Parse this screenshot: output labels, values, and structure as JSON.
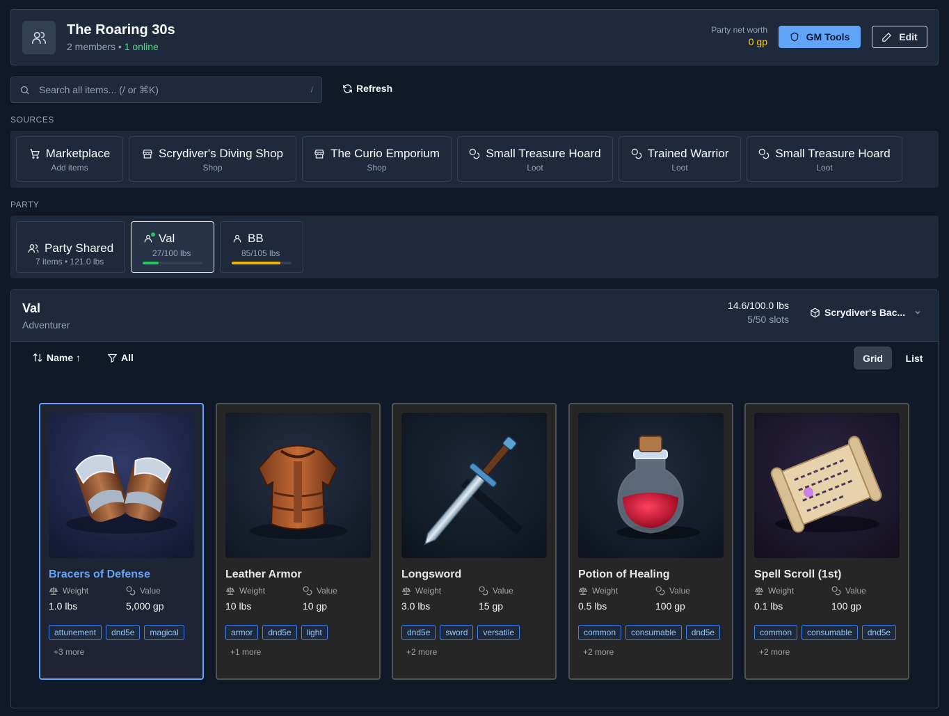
{
  "header": {
    "title": "The Roaring 30s",
    "members": "2 members",
    "separator": "•",
    "online": "1 online",
    "net_worth_label": "Party net worth",
    "net_worth_value": "0 gp",
    "gm_tools_label": "GM Tools",
    "edit_label": "Edit"
  },
  "search": {
    "placeholder": "Search all items... (/ or ⌘K)",
    "shortcut": "/",
    "refresh_label": "Refresh"
  },
  "sources": {
    "label": "SOURCES",
    "items": [
      {
        "name": "Marketplace",
        "sub": "Add items",
        "icon": "cart-icon"
      },
      {
        "name": "Scrydiver's Diving Shop",
        "sub": "Shop",
        "icon": "store-icon"
      },
      {
        "name": "The Curio Emporium",
        "sub": "Shop",
        "icon": "store-icon"
      },
      {
        "name": "Small Treasure Hoard",
        "sub": "Loot",
        "icon": "coins-icon"
      },
      {
        "name": "Trained Warrior",
        "sub": "Loot",
        "icon": "coins-icon"
      },
      {
        "name": "Small Treasure Hoard",
        "sub": "Loot",
        "icon": "coins-icon"
      }
    ]
  },
  "party": {
    "label": "PARTY",
    "shared": {
      "name": "Party Shared",
      "sub": "7 items • 121.0 lbs"
    },
    "members": [
      {
        "name": "Val",
        "sub": "27/100 lbs",
        "load": 0.27,
        "bar_color": "#22c55e",
        "online": true
      },
      {
        "name": "BB",
        "sub": "85/105 lbs",
        "load": 0.81,
        "bar_color": "#eab308",
        "online": false
      }
    ]
  },
  "inventory": {
    "name": "Val",
    "role": "Adventurer",
    "weight": "14.6/100.0 lbs",
    "slots": "5/50 slots",
    "container": "Scrydiver's Bac...",
    "sort_label": "Name ↑",
    "filter_label": "All",
    "view_grid": "Grid",
    "view_list": "List",
    "weight_label": "Weight",
    "value_label": "Value",
    "items": [
      {
        "name": "Bracers of Defense",
        "weight": "1.0 lbs",
        "value": "5,000 gp",
        "tags": [
          "attunement",
          "dnd5e",
          "magical"
        ],
        "more": "+3 more"
      },
      {
        "name": "Leather Armor",
        "weight": "10 lbs",
        "value": "10 gp",
        "tags": [
          "armor",
          "dnd5e",
          "light"
        ],
        "more": "+1 more"
      },
      {
        "name": "Longsword",
        "weight": "3.0 lbs",
        "value": "15 gp",
        "tags": [
          "dnd5e",
          "sword",
          "versatile"
        ],
        "more": "+2 more"
      },
      {
        "name": "Potion of Healing",
        "weight": "0.5 lbs",
        "value": "100 gp",
        "tags": [
          "common",
          "consumable",
          "dnd5e"
        ],
        "more": "+2 more"
      },
      {
        "name": "Spell Scroll (1st)",
        "weight": "0.1 lbs",
        "value": "100 gp",
        "tags": [
          "common",
          "consumable",
          "dnd5e"
        ],
        "more": "+2 more"
      }
    ]
  },
  "colors": {
    "accent": "#60a5fa",
    "online": "#4ade80",
    "gold": "#facc15"
  }
}
